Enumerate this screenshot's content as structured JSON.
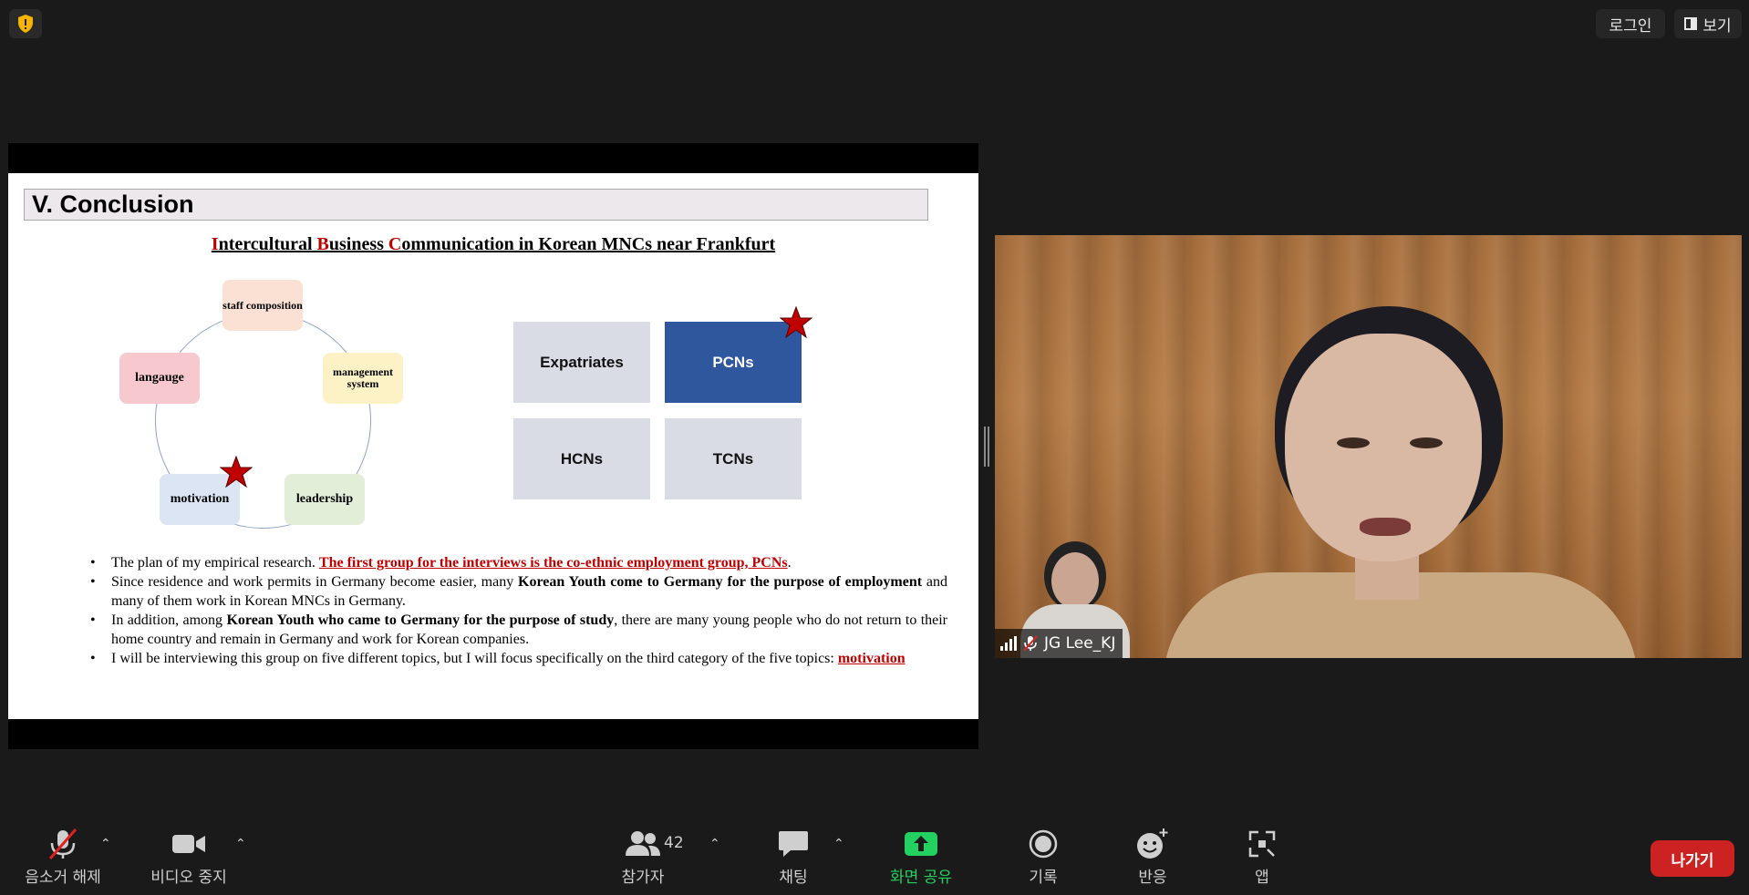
{
  "topbar": {
    "login_label": "로그인",
    "view_label": "보기"
  },
  "slide": {
    "title": "V. Conclusion",
    "subtitle_parts": [
      "I",
      "ntercultural ",
      "B",
      "usiness ",
      "C",
      "ommunication in Korean MNCs near Frankfurt"
    ],
    "cycle_nodes": {
      "staff": "staff composition",
      "language": "langauge",
      "management": "management system",
      "motivation": "motivation",
      "leadership": "leadership"
    },
    "groups": {
      "expatriates": "Expatriates",
      "pcns": "PCNs",
      "hcns": "HCNs",
      "tcns": "TCNs"
    },
    "bullets": {
      "b1_a": "The plan of my empirical research. ",
      "b1_b": "The first group for the interviews is the co-ethnic employment group, PCNs",
      "b1_c": ".",
      "b2_a": "Since residence and work permits in Germany become easier, many ",
      "b2_b": "Korean Youth come to Germany for the purpose of employment",
      "b2_c": " and many of them work in Korean MNCs in Germany.",
      "b3_a": " In addition, among ",
      "b3_b": "Korean Youth who came to Germany for the purpose of study",
      "b3_c": ", there are many young people who do not return to their home country and remain in Germany and work for Korean companies.",
      "b4_a": "I will be interviewing this group on five different topics, but I will focus specifically on the third category of the five topics: ",
      "b4_b": "motivation"
    }
  },
  "video": {
    "participant_name": "JG Lee_KJ"
  },
  "toolbar": {
    "mute_label": "음소거 해제",
    "video_label": "비디오 중지",
    "participants_label": "참가자",
    "participants_count": "42",
    "chat_label": "채팅",
    "share_label": "화면 공유",
    "record_label": "기록",
    "reactions_label": "반응",
    "apps_label": "앱",
    "leave_label": "나가기"
  },
  "colors": {
    "share_green": "#23d160",
    "leave_red": "#cc2222",
    "pcn_blue": "#2f579e",
    "slide_red": "#c00000"
  }
}
